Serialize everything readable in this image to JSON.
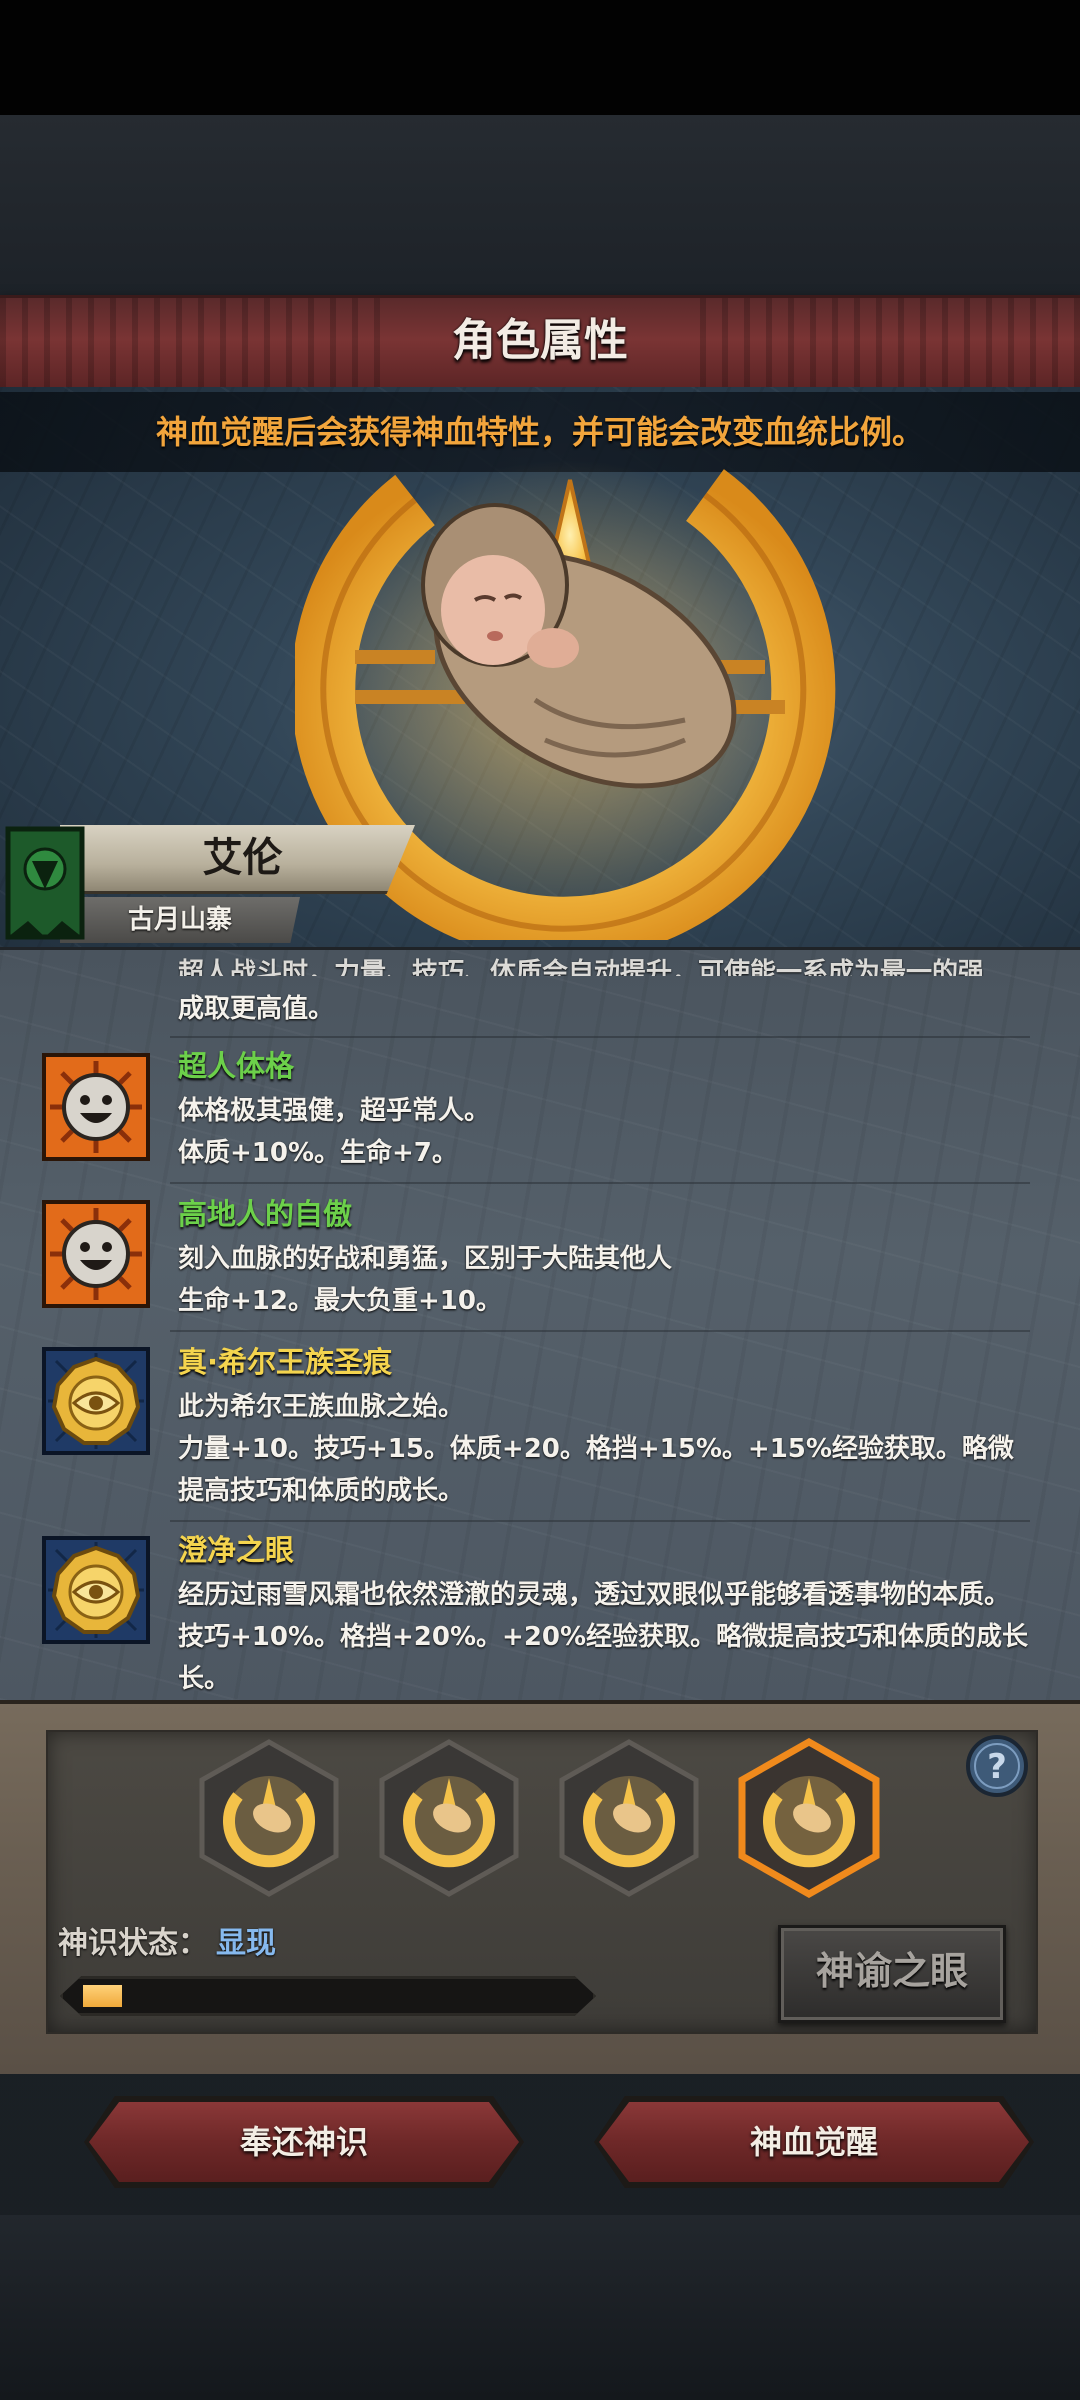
{
  "header": {
    "title": "角色属性",
    "subtitle": "神血觉醒后会获得神血特性，并可能会改变血统比例。"
  },
  "character": {
    "name": "艾伦",
    "region": "古月山寨"
  },
  "traits": {
    "partial_top_lines": [
      "超人战斗时，力量、技巧、体质会自动提升，可使能一系成为最一的强",
      "成取更高值。"
    ],
    "items": [
      {
        "title": "超人体格",
        "icon": "smiley-sun-icon",
        "lines": [
          "体格极其强健，超乎常人。",
          "体质+10%。生命+7。"
        ]
      },
      {
        "title": "高地人的自傲",
        "icon": "smiley-sun-icon",
        "lines": [
          "刻入血脉的好战和勇猛，区别于大陆其他人",
          "生命+12。最大负重+10。"
        ]
      },
      {
        "title": "真·希尔王族圣痕",
        "icon": "golden-eye-seal-icon",
        "lines": [
          "此为希尔王族血脉之始。",
          "力量+10。技巧+15。体质+20。格挡+15%。+15%经验获取。略微",
          "提高技巧和体质的成长。"
        ]
      },
      {
        "title": "澄净之眼",
        "icon": "golden-eye-seal-icon",
        "lines": [
          "经历过雨雪风霜也依然澄澈的灵魂，透过双眼似乎能够看透事物的本质。",
          "技巧+10%。格挡+20%。+20%经验获取。略微提高技巧和体质的成长",
          "长。"
        ]
      }
    ]
  },
  "divine_sense": {
    "status_label": "神识状态：",
    "status_value": "显现",
    "progress": 0.08,
    "oracle_button": "神谕之眼",
    "slots": [
      {
        "icon": "crescent-emblem-icon",
        "selected": false
      },
      {
        "icon": "crescent-emblem-icon",
        "selected": false
      },
      {
        "icon": "crescent-emblem-icon",
        "selected": false
      },
      {
        "icon": "crescent-emblem-icon",
        "selected": true
      }
    ]
  },
  "actions": {
    "return_button": "奉还神识",
    "awaken_button": "神血觉醒"
  },
  "colors": {
    "title_banner": "#7a3434",
    "subtitle": "#f2a53c",
    "trait_green": "#6cd04a",
    "trait_yellow": "#f4d44e",
    "status_value": "#86b9ee",
    "selected_slot": "#f08a1c"
  }
}
